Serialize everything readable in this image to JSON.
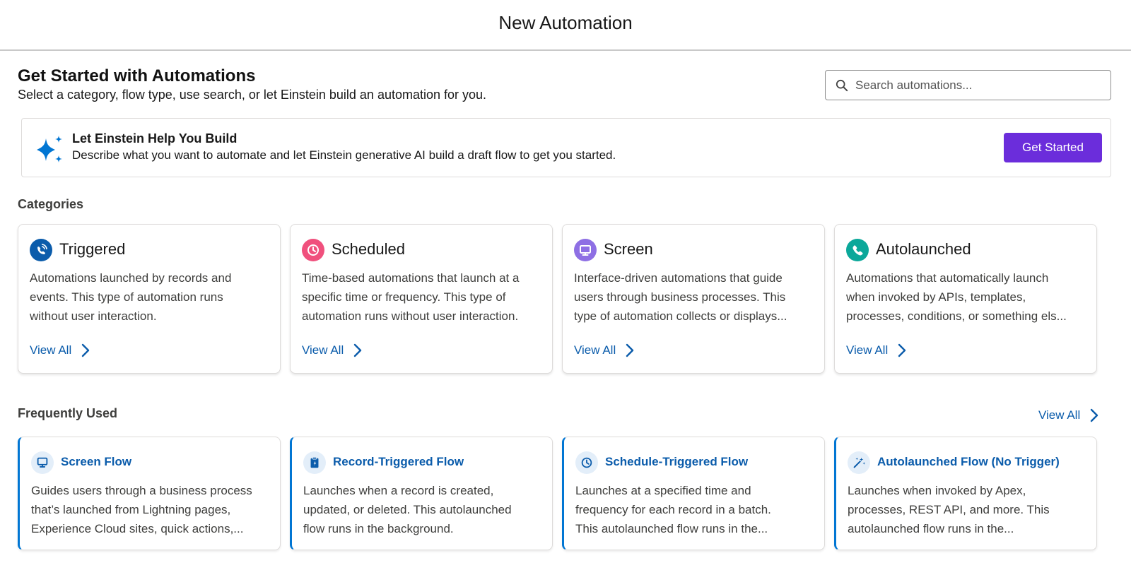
{
  "header": {
    "title": "New Automation"
  },
  "intro": {
    "title": "Get Started with Automations",
    "subtitle": "Select a category, flow type, use search, or let Einstein build an automation for you."
  },
  "search": {
    "placeholder": "Search automations..."
  },
  "einstein": {
    "title": "Let Einstein Help You Build",
    "description": "Describe what you want to automate and let Einstein generative AI build a draft flow to get you started.",
    "button_label": "Get Started",
    "accent": "#6b2ddb"
  },
  "categories": {
    "heading": "Categories",
    "view_all_label": "View All",
    "items": [
      {
        "title": "Triggered",
        "icon": "triggered-icon",
        "color": "#0b5cab",
        "lines": [
          "Automations launched by records and",
          "events. This type of automation runs",
          "without user interaction."
        ]
      },
      {
        "title": "Scheduled",
        "icon": "clock-icon",
        "color": "#f0507d",
        "lines": [
          "Time-based automations that launch at a",
          "specific time or frequency. This type of",
          "automation runs without user interaction."
        ]
      },
      {
        "title": "Screen",
        "icon": "screen-icon",
        "color": "#8e6fe4",
        "lines": [
          "Interface-driven automations that guide",
          "users through business processes. This",
          "type of automation collects or displays..."
        ]
      },
      {
        "title": "Autolaunched",
        "icon": "phone-icon",
        "color": "#0ba89a",
        "lines": [
          "Automations that automatically launch",
          "when invoked by APIs, templates,",
          "processes, conditions, or something els..."
        ]
      }
    ]
  },
  "frequently_used": {
    "heading": "Frequently Used",
    "view_all_label": "View All",
    "items": [
      {
        "title": "Screen Flow",
        "icon": "screen-icon",
        "lines": [
          "Guides users through a business process",
          "that’s launched from Lightning pages,",
          "Experience Cloud sites, quick actions,..."
        ]
      },
      {
        "title": "Record-Triggered Flow",
        "icon": "clipboard-icon",
        "lines": [
          "Launches when a record is created,",
          "updated, or deleted. This autolaunched",
          "flow runs in the background."
        ]
      },
      {
        "title": "Schedule-Triggered Flow",
        "icon": "clock-icon",
        "lines": [
          "Launches at a specified time and",
          "frequency for each record in a batch.",
          "This autolaunched flow runs in the..."
        ]
      },
      {
        "title": "Autolaunched Flow (No Trigger)",
        "icon": "magic-wand-icon",
        "lines": [
          "Launches when invoked by Apex,",
          "processes, REST API, and more. This",
          "autolaunched flow runs in the..."
        ]
      }
    ]
  },
  "colors": {
    "link": "#0b5cab",
    "flow_accent": "#0176d3"
  }
}
